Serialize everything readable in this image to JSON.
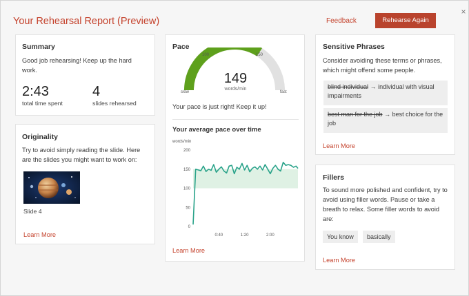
{
  "header": {
    "title": "Your Rehearsal Report (Preview)",
    "feedback": "Feedback",
    "rehearse_again": "Rehearse Again",
    "close": "×"
  },
  "summary": {
    "title": "Summary",
    "text": "Good job rehearsing! Keep up the hard work.",
    "time_value": "2:43",
    "time_label": "total time spent",
    "slides_value": "4",
    "slides_label": "slides rehearsed"
  },
  "originality": {
    "title": "Originality",
    "text": "Try to avoid simply reading the slide. Here are the slides you might want to work on:",
    "slide_label": "Slide 4",
    "learn_more": "Learn More"
  },
  "pace": {
    "title": "Pace",
    "value": "149",
    "value_number": 149,
    "unit": "words/min",
    "label_low": "100",
    "label_high": "150",
    "label_slow": "slow",
    "label_fast": "fast",
    "message": "Your pace is just right! Keep it up!",
    "chart_title": "Your average pace over time",
    "y_unit": "words/min",
    "learn_more": "Learn More"
  },
  "chart_data": {
    "type": "line",
    "title": "Your average pace over time",
    "ylabel": "words/min",
    "xlabel": "",
    "y_ticks": [
      "200",
      "150",
      "100",
      "50",
      "0"
    ],
    "x_ticks": [
      "0:40",
      "1:20",
      "2:00"
    ],
    "ylim": [
      0,
      200
    ],
    "xlim": [
      0,
      163
    ],
    "target_band": [
      100,
      150
    ],
    "x": [
      0,
      4,
      8,
      12,
      16,
      20,
      24,
      28,
      32,
      36,
      40,
      44,
      48,
      52,
      56,
      60,
      64,
      68,
      72,
      76,
      80,
      84,
      88,
      92,
      96,
      100,
      104,
      108,
      112,
      116,
      120,
      124,
      128,
      132,
      136,
      140,
      144,
      148,
      152,
      156,
      160,
      163
    ],
    "values": [
      5,
      150,
      148,
      146,
      158,
      144,
      150,
      147,
      162,
      142,
      150,
      156,
      145,
      140,
      158,
      160,
      138,
      155,
      150,
      165,
      148,
      160,
      143,
      152,
      156,
      150,
      158,
      148,
      162,
      150,
      138,
      152,
      160,
      150,
      145,
      168,
      160,
      162,
      160,
      155,
      158,
      152
    ]
  },
  "sensitive": {
    "title": "Sensitive Phrases",
    "text": "Consider avoiding these terms or phrases, which might offend some people.",
    "phrase1_old": "blind individual",
    "phrase1_new": "individual with visual impairments",
    "phrase2_old": "best man for the job",
    "phrase2_new": "best choice for the job",
    "arrow": "→",
    "learn_more": "Learn More"
  },
  "fillers": {
    "title": "Fillers",
    "text": "To sound more polished and confident, try to avoid using filler words. Pause or take a breath to relax. Some filler words to avoid are:",
    "chips": [
      "You know",
      "basically"
    ],
    "learn_more": "Learn More"
  },
  "colors": {
    "accent": "#c4412b",
    "button": "#b9432d",
    "gauge_green": "#5ea01c",
    "gauge_gray": "#e1e1e1",
    "line": "#2aa38a",
    "band": "#dff1e4"
  }
}
